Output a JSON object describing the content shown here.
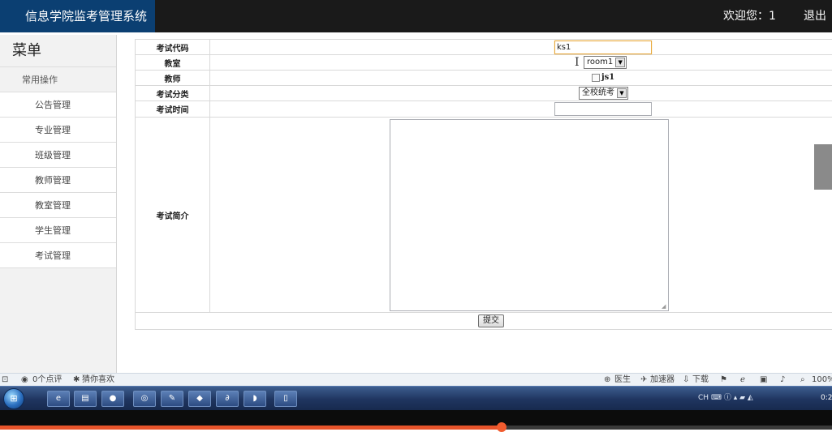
{
  "header": {
    "brand": "信息学院监考管理系统",
    "welcome": "欢迎您：1",
    "logout": "退出"
  },
  "sidebar": {
    "title": "菜单",
    "group": "常用操作",
    "items": [
      "公告管理",
      "专业管理",
      "班级管理",
      "教师管理",
      "教室管理",
      "学生管理",
      "考试管理"
    ]
  },
  "form": {
    "code_label": "考试代码",
    "code_value": "ks1",
    "room_label": "教室",
    "room_selected": "room1",
    "teacher_label": "教师",
    "teacher_option": "js1",
    "category_label": "考试分类",
    "category_selected": "全校统考",
    "time_label": "考试时间",
    "time_value": "",
    "intro_label": "考试简介",
    "intro_value": "",
    "submit": "提交"
  },
  "statusbar": {
    "comments": "0个点评",
    "guess": "猜你喜欢",
    "doctor": "医生",
    "accelerator": "加速器",
    "download": "下载",
    "zoom": "100%"
  },
  "taskbar": {
    "tray_lang": "CH",
    "clock": "0:2"
  },
  "player": {
    "progress": 0.603
  },
  "colors": {
    "header_bg": "#1a1a1a",
    "brand_bg": "#0b3f72",
    "sidebar_bg": "#f2f2f2",
    "focus_border": "#e8a93e",
    "progress": "#e8542b"
  }
}
